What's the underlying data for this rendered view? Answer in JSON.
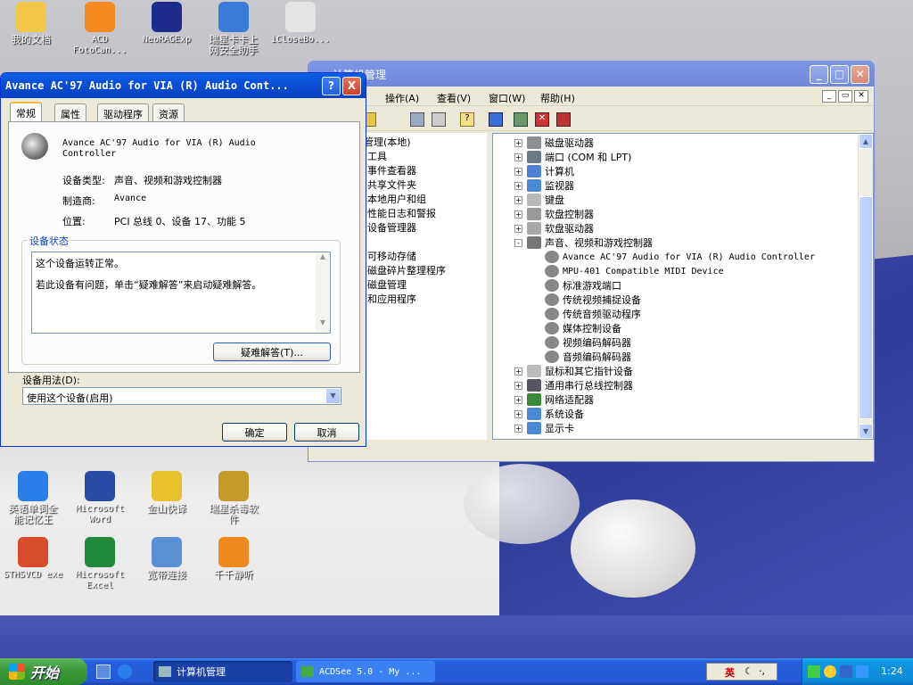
{
  "desktop": {
    "icons_top": [
      {
        "label": "我的文档",
        "color": "#f3c84a",
        "glyph": "folder-icon"
      },
      {
        "label": "ACD\nFotoCan...",
        "color": "#f58a1f",
        "glyph": "acd-icon"
      },
      {
        "label": "NeoRAGExp",
        "color": "#1d2b8a",
        "glyph": "neorage-icon"
      },
      {
        "label": "瑞星卡卡上\n网安全助手",
        "color": "#3a7ad8",
        "glyph": "rising-kaka-icon"
      },
      {
        "label": "iCloseBo...",
        "color": "#e4e4e4",
        "glyph": "iclose-icon"
      }
    ],
    "icons_bottom": [
      {
        "label": "英语单词全\n能记忆王",
        "color": "#2b7de9",
        "glyph": "ie-icon"
      },
      {
        "label": "Microsoft\nWord",
        "color": "#2a4aa8",
        "glyph": "word-icon"
      },
      {
        "label": "金山快译",
        "color": "#e8c22c",
        "glyph": "kingsoft-icon"
      },
      {
        "label": "瑞星杀毒软\n件",
        "color": "#c49b2a",
        "glyph": "rising-av-icon"
      },
      {
        "label": "STHSVCD exe",
        "color": "#d84c2c",
        "glyph": "sthsvcd-icon"
      },
      {
        "label": "Microsoft\nExcel",
        "color": "#1e8a3a",
        "glyph": "excel-icon"
      },
      {
        "label": "宽带连接",
        "color": "#5b8fd4",
        "glyph": "broadband-icon"
      },
      {
        "label": "千千静听",
        "color": "#f08a20",
        "glyph": "ttplayer-icon"
      }
    ]
  },
  "dialog": {
    "title": "Avance AC'97 Audio for VIA (R) Audio Cont...",
    "help_btn": "?",
    "close_btn": "X",
    "tabs": [
      "常规",
      "属性",
      "驱动程序",
      "资源"
    ],
    "device_name": "Avance AC'97 Audio for VIA (R) Audio\nController",
    "type_label": "设备类型:",
    "type_value": "声音、视频和游戏控制器",
    "maker_label": "制造商:",
    "maker_value": "Avance",
    "loc_label": "位置:",
    "loc_value": "PCI 总线 0、设备 17、功能 5",
    "status_group": "设备状态",
    "status_line1": "这个设备运转正常。",
    "status_line2": "若此设备有问题，单击“疑难解答”来启动疑难解答。",
    "troubleshoot_btn": "疑难解答(T)...",
    "usage_label": "设备用法(D):",
    "usage_value": "使用这个设备(启用)",
    "ok_btn": "确定",
    "cancel_btn": "取消"
  },
  "mgmt": {
    "title": "计算机管理",
    "menus": [
      "操作(A)",
      "查看(V)",
      "窗口(W)",
      "帮助(H)"
    ],
    "left_tree": [
      "管理(本地)",
      "工具",
      "事件查看器",
      "共享文件夹",
      "本地用户和组",
      "性能日志和警报",
      "设备管理器",
      "",
      "可移动存储",
      "磁盘碎片整理程序",
      "磁盘管理",
      "和应用程序"
    ],
    "right_tree": [
      {
        "label": "磁盘驱动器",
        "lvl": 0,
        "exp": "+"
      },
      {
        "label": "端口 (COM 和 LPT)",
        "lvl": 0,
        "exp": "+"
      },
      {
        "label": "计算机",
        "lvl": 0,
        "exp": "+"
      },
      {
        "label": "监视器",
        "lvl": 0,
        "exp": "+"
      },
      {
        "label": "键盘",
        "lvl": 0,
        "exp": "+"
      },
      {
        "label": "软盘控制器",
        "lvl": 0,
        "exp": "+"
      },
      {
        "label": "软盘驱动器",
        "lvl": 0,
        "exp": "+"
      },
      {
        "label": "声音、视频和游戏控制器",
        "lvl": 0,
        "exp": "-"
      },
      {
        "label": "Avance AC'97 Audio for VIA (R) Audio Controller",
        "lvl": 1,
        "exp": ""
      },
      {
        "label": "MPU-401 Compatible MIDI Device",
        "lvl": 1,
        "exp": ""
      },
      {
        "label": "标准游戏端口",
        "lvl": 1,
        "exp": ""
      },
      {
        "label": "传统视频捕捉设备",
        "lvl": 1,
        "exp": ""
      },
      {
        "label": "传统音频驱动程序",
        "lvl": 1,
        "exp": ""
      },
      {
        "label": "媒体控制设备",
        "lvl": 1,
        "exp": ""
      },
      {
        "label": "视频编码解码器",
        "lvl": 1,
        "exp": ""
      },
      {
        "label": "音频编码解码器",
        "lvl": 1,
        "exp": ""
      },
      {
        "label": "鼠标和其它指针设备",
        "lvl": 0,
        "exp": "+"
      },
      {
        "label": "通用串行总线控制器",
        "lvl": 0,
        "exp": "+"
      },
      {
        "label": "网络适配器",
        "lvl": 0,
        "exp": "+"
      },
      {
        "label": "系统设备",
        "lvl": 0,
        "exp": "+"
      },
      {
        "label": "显示卡",
        "lvl": 0,
        "exp": "+"
      }
    ]
  },
  "taskbar": {
    "start": "开始",
    "tasks": [
      "计算机管理",
      "ACDSee 5.0 - My ..."
    ],
    "ime": "英",
    "clock": "1:24"
  },
  "colors": {
    "titlebar": "#0a4fd6",
    "start": "#3c9a3c",
    "taskbar": "#235ad6"
  }
}
